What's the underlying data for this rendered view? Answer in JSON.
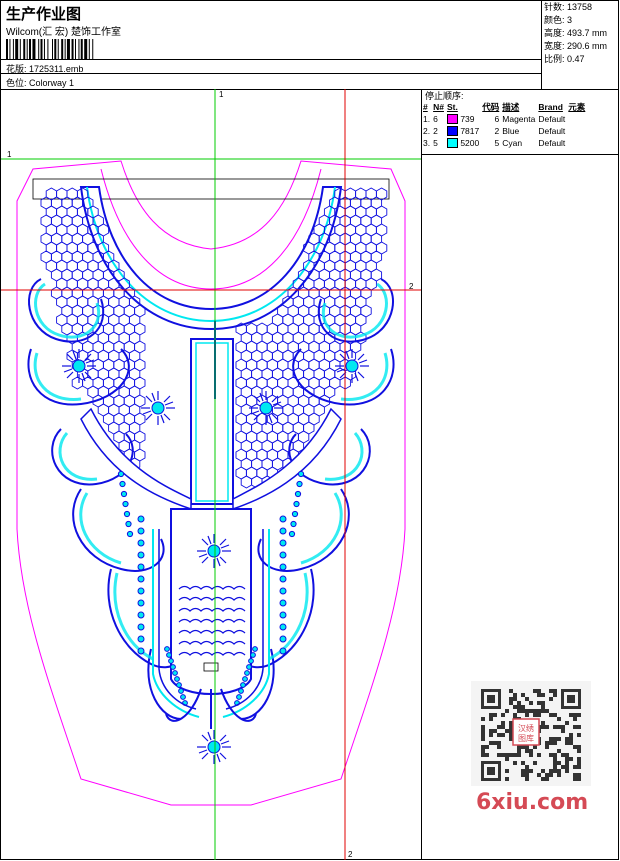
{
  "header": {
    "title": "生产作业图",
    "studio": "Wilcom(汇 宏) 楚饰工作室",
    "design_file_label": "花版:",
    "design_file": "1725311.emb",
    "colorway_label": "色位:",
    "colorway": "Colorway 1"
  },
  "stats": {
    "stitches_label": "针数:",
    "stitches": "13758",
    "colors_label": "颜色:",
    "colors": "3",
    "height_label": "高度:",
    "height": "493.7 mm",
    "width_label": "宽度:",
    "width": "290.6 mm",
    "scale_label": "比例:",
    "scale": "0.47"
  },
  "stop_sequence": {
    "title": "停止顺序:",
    "headers": [
      "#",
      "N#",
      "St.",
      "代码",
      "描述",
      "Brand",
      "元素"
    ],
    "rows": [
      {
        "num": "1.",
        "n": "6",
        "color": "#ff00ff",
        "st": "739",
        "code": "6",
        "desc": "Magenta",
        "brand": "Default"
      },
      {
        "num": "2.",
        "n": "2",
        "color": "#0000ff",
        "st": "7817",
        "code": "2",
        "desc": "Blue",
        "brand": "Default"
      },
      {
        "num": "3.",
        "n": "5",
        "color": "#00ffff",
        "st": "5200",
        "code": "5",
        "desc": "Cyan",
        "brand": "Default"
      }
    ]
  },
  "guides": {
    "green_v": "1",
    "green_h": "1",
    "red_h": "2",
    "red_v": "2"
  },
  "watermark": {
    "text": "6xiu.com",
    "seal": "汉绣图库"
  },
  "colors": {
    "magenta": "#ff00ff",
    "blue": "#1010e0",
    "cyan": "#00e8f0",
    "guide_green": "#00cc00",
    "guide_red": "#e00000"
  }
}
